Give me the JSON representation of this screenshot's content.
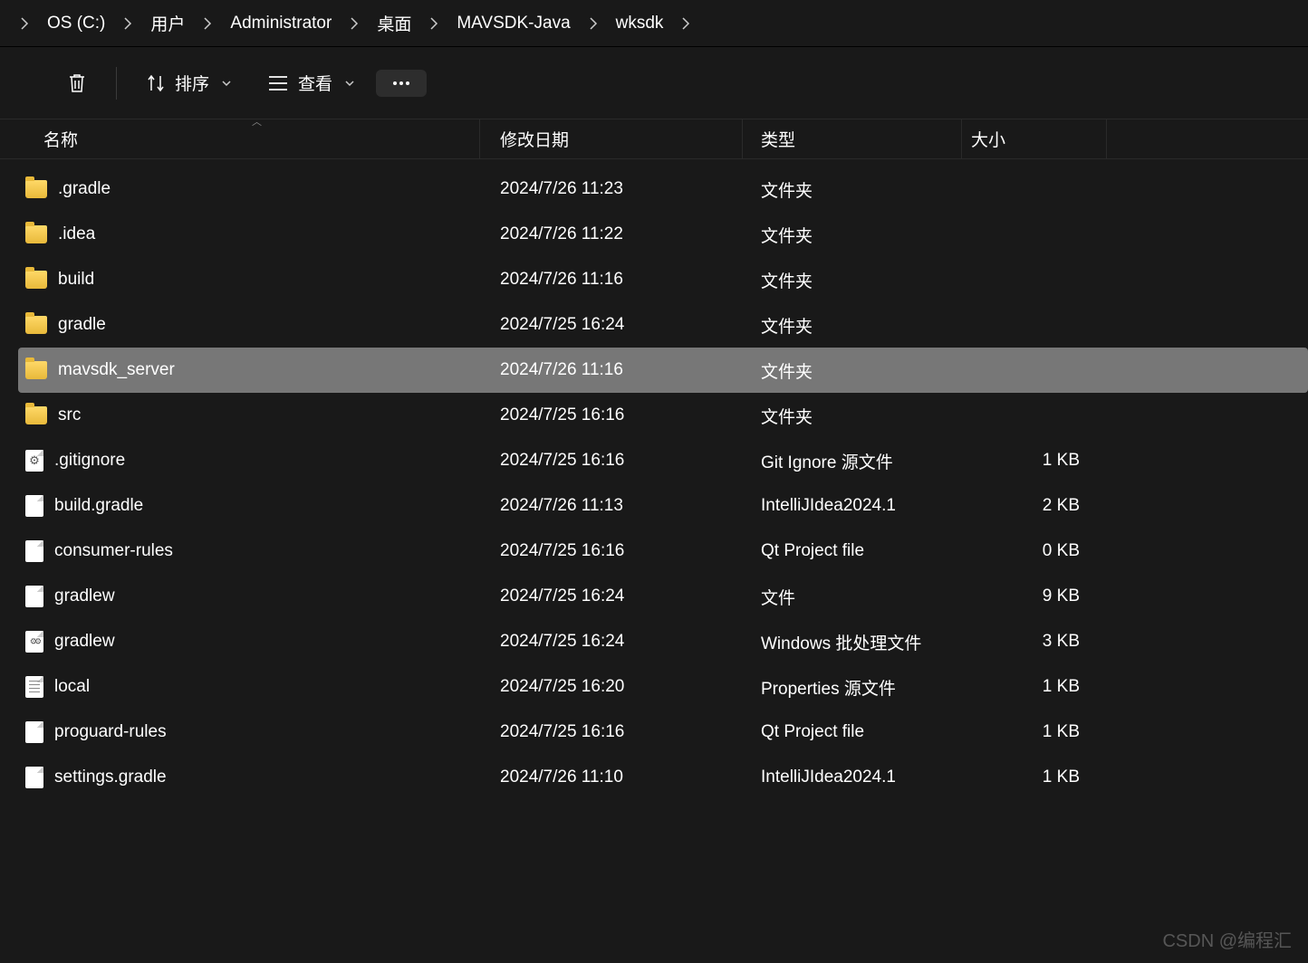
{
  "breadcrumb": [
    "OS (C:)",
    "用户",
    "Administrator",
    "桌面",
    "MAVSDK-Java",
    "wksdk"
  ],
  "toolbar": {
    "sort_label": "排序",
    "view_label": "查看"
  },
  "columns": {
    "name": "名称",
    "date": "修改日期",
    "type": "类型",
    "size": "大小"
  },
  "rows": [
    {
      "icon": "folder",
      "name": ".gradle",
      "date": "2024/7/26 11:23",
      "type": "文件夹",
      "size": "",
      "selected": false
    },
    {
      "icon": "folder",
      "name": ".idea",
      "date": "2024/7/26 11:22",
      "type": "文件夹",
      "size": "",
      "selected": false
    },
    {
      "icon": "folder",
      "name": "build",
      "date": "2024/7/26 11:16",
      "type": "文件夹",
      "size": "",
      "selected": false
    },
    {
      "icon": "folder",
      "name": "gradle",
      "date": "2024/7/25 16:24",
      "type": "文件夹",
      "size": "",
      "selected": false
    },
    {
      "icon": "folder",
      "name": "mavsdk_server",
      "date": "2024/7/26 11:16",
      "type": "文件夹",
      "size": "",
      "selected": true
    },
    {
      "icon": "folder",
      "name": "src",
      "date": "2024/7/25 16:16",
      "type": "文件夹",
      "size": "",
      "selected": false
    },
    {
      "icon": "gear",
      "name": ".gitignore",
      "date": "2024/7/25 16:16",
      "type": "Git Ignore 源文件",
      "size": "1 KB",
      "selected": false
    },
    {
      "icon": "file",
      "name": "build.gradle",
      "date": "2024/7/26 11:13",
      "type": "IntelliJIdea2024.1",
      "size": "2 KB",
      "selected": false
    },
    {
      "icon": "file",
      "name": "consumer-rules",
      "date": "2024/7/25 16:16",
      "type": "Qt Project file",
      "size": "0 KB",
      "selected": false
    },
    {
      "icon": "file",
      "name": "gradlew",
      "date": "2024/7/25 16:24",
      "type": "文件",
      "size": "9 KB",
      "selected": false
    },
    {
      "icon": "batch",
      "name": "gradlew",
      "date": "2024/7/25 16:24",
      "type": "Windows 批处理文件",
      "size": "3 KB",
      "selected": false
    },
    {
      "icon": "text",
      "name": "local",
      "date": "2024/7/25 16:20",
      "type": "Properties 源文件",
      "size": "1 KB",
      "selected": false
    },
    {
      "icon": "file",
      "name": "proguard-rules",
      "date": "2024/7/25 16:16",
      "type": "Qt Project file",
      "size": "1 KB",
      "selected": false
    },
    {
      "icon": "file",
      "name": "settings.gradle",
      "date": "2024/7/26 11:10",
      "type": "IntelliJIdea2024.1",
      "size": "1 KB",
      "selected": false
    }
  ],
  "watermark": "CSDN @编程汇"
}
